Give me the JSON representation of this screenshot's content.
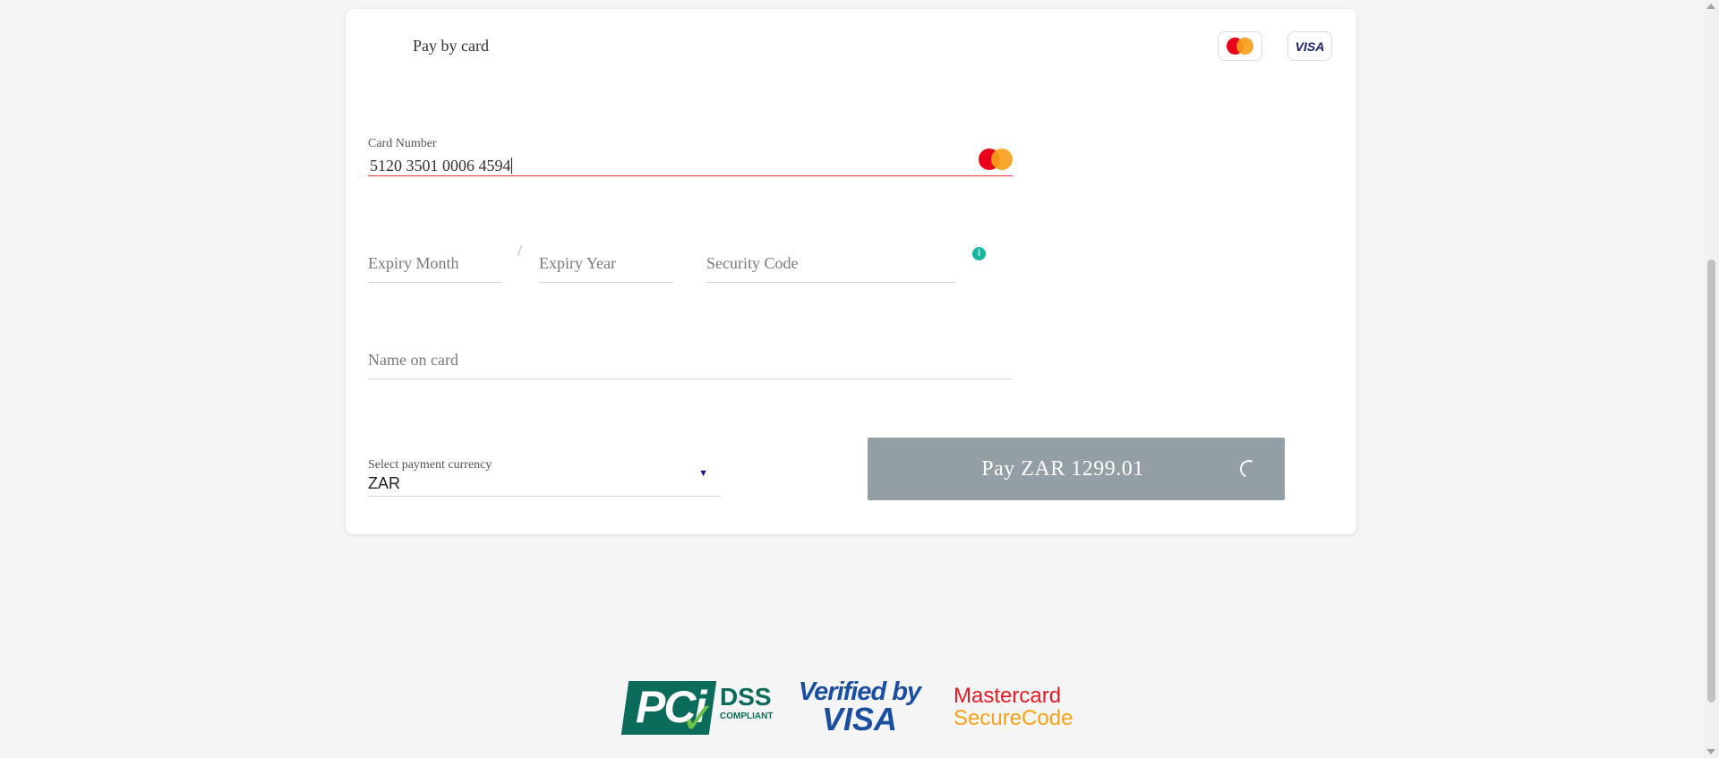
{
  "card": {
    "title": "Pay by card",
    "brands": [
      "mastercard",
      "visa"
    ],
    "visa_label": "VISA"
  },
  "form": {
    "card_number": {
      "label": "Card Number",
      "value": "5120 3501 0006 4594",
      "state": "error",
      "error_color": "#e53935"
    },
    "expiry_month": {
      "placeholder": "Expiry Month"
    },
    "separator": "/",
    "expiry_year": {
      "placeholder": "Expiry Year"
    },
    "security_code": {
      "placeholder": "Security Code",
      "info_icon": "i"
    },
    "name_on_card": {
      "placeholder": "Name on card"
    },
    "currency": {
      "label": "Select payment currency",
      "value": "ZAR"
    }
  },
  "pay_button": {
    "label": "Pay  ZAR 1299.01",
    "state": "loading",
    "color": "#939ea5"
  },
  "trust_logos": {
    "pci": {
      "main": "PCi",
      "dss": "DSS",
      "compliant": "COMPLIANT"
    },
    "verified_by_visa": {
      "line1": "Verified by",
      "line2": "VISA"
    },
    "mastercard_securecode": {
      "line1": "Mastercard",
      "line2": "SecureCode"
    }
  },
  "colors": {
    "mastercard_red": "#eb001b",
    "mastercard_orange": "#f79e1b",
    "visa_blue": "#1a1f71",
    "pci_green": "#0b6c5c",
    "info_teal": "#17b6a0"
  }
}
